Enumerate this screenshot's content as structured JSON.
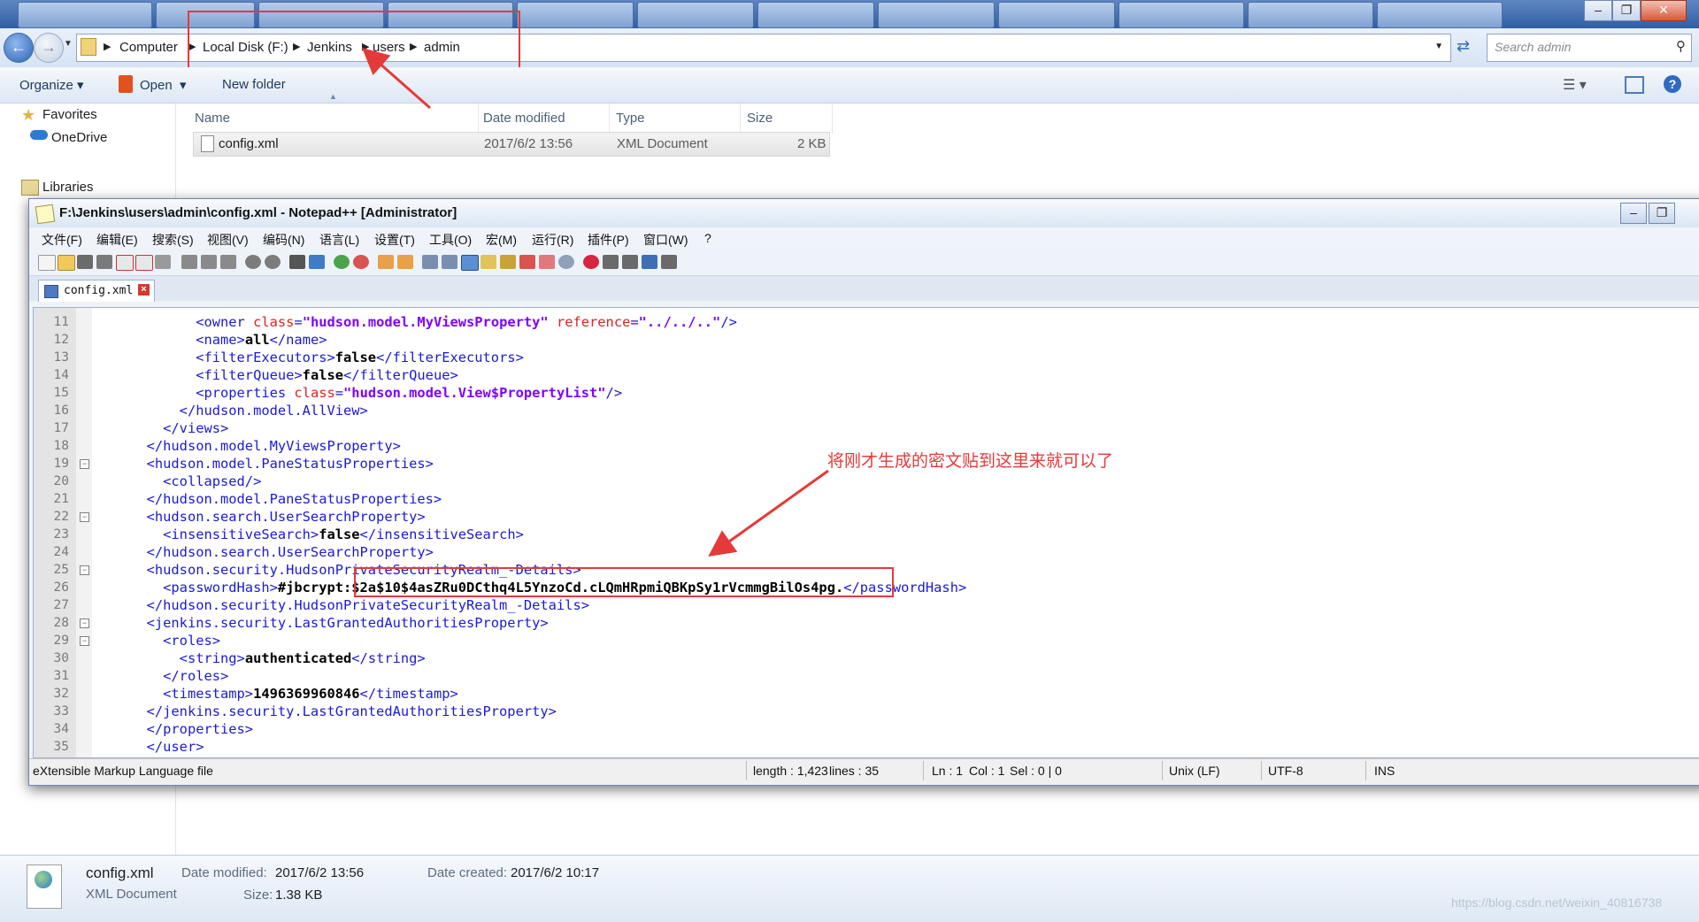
{
  "explorer": {
    "breadcrumbs": [
      "Computer",
      "Local Disk (F:)",
      "Jenkins",
      "users",
      "admin"
    ],
    "search_placeholder": "Search admin",
    "toolbar": {
      "organize": "Organize",
      "open": "Open",
      "new_folder": "New folder"
    },
    "nav": {
      "favorites": "Favorites",
      "onedrive": "OneDrive",
      "libraries": "Libraries"
    },
    "columns": {
      "name": "Name",
      "date_modified": "Date modified",
      "type": "Type",
      "size": "Size"
    },
    "file": {
      "name": "config.xml",
      "date": "2017/6/2 13:56",
      "type": "XML Document",
      "size": "2 KB"
    },
    "details": {
      "name": "config.xml",
      "kind": "XML Document",
      "date_modified_label": "Date modified:",
      "date_modified": "2017/6/2 13:56",
      "size_label": "Size:",
      "size": "1.38 KB",
      "date_created_label": "Date created:",
      "date_created": "2017/6/2 10:17"
    }
  },
  "notepad": {
    "title": "F:\\Jenkins\\users\\admin\\config.xml - Notepad++ [Administrator]",
    "menu": [
      "文件(F)",
      "编辑(E)",
      "搜索(S)",
      "视图(V)",
      "编码(N)",
      "语言(L)",
      "设置(T)",
      "工具(O)",
      "宏(M)",
      "运行(R)",
      "插件(P)",
      "窗口(W)",
      "?"
    ],
    "tab": "config.xml",
    "lines": [
      {
        "n": "11",
        "p": [
          [
            "      ",
            ""
          ],
          [
            "<owner ",
            "tag"
          ],
          [
            "class",
            "attr"
          ],
          [
            "=",
            "tag"
          ],
          [
            "\"hudson.model.MyViewsProperty\"",
            "val"
          ],
          [
            " reference",
            "attr"
          ],
          [
            "=",
            "tag"
          ],
          [
            "\"../../..\"",
            "val"
          ],
          [
            "/>",
            "tag"
          ]
        ]
      },
      {
        "n": "12",
        "p": [
          [
            "      ",
            ""
          ],
          [
            "<name>",
            "tag"
          ],
          [
            "all",
            "txt"
          ],
          [
            "</name>",
            "tag"
          ]
        ]
      },
      {
        "n": "13",
        "p": [
          [
            "      ",
            ""
          ],
          [
            "<filterExecutors>",
            "tag"
          ],
          [
            "false",
            "txt"
          ],
          [
            "</filterExecutors>",
            "tag"
          ]
        ]
      },
      {
        "n": "14",
        "p": [
          [
            "      ",
            ""
          ],
          [
            "<filterQueue>",
            "tag"
          ],
          [
            "false",
            "txt"
          ],
          [
            "</filterQueue>",
            "tag"
          ]
        ]
      },
      {
        "n": "15",
        "p": [
          [
            "      ",
            ""
          ],
          [
            "<properties ",
            "tag"
          ],
          [
            "class",
            "attr"
          ],
          [
            "=",
            "tag"
          ],
          [
            "\"hudson.model.View$PropertyList\"",
            "val"
          ],
          [
            "/>",
            "tag"
          ]
        ]
      },
      {
        "n": "16",
        "p": [
          [
            "    ",
            ""
          ],
          [
            "</hudson.model.AllView>",
            "tag"
          ]
        ]
      },
      {
        "n": "17",
        "p": [
          [
            "  ",
            ""
          ],
          [
            "</views>",
            "tag"
          ]
        ]
      },
      {
        "n": "18",
        "p": [
          [
            "",
            ""
          ],
          [
            "</hudson.model.MyViewsProperty>",
            "tag"
          ]
        ]
      },
      {
        "n": "19",
        "p": [
          [
            "",
            ""
          ],
          [
            "<hudson.model.PaneStatusProperties>",
            "tag"
          ]
        ]
      },
      {
        "n": "20",
        "p": [
          [
            "  ",
            ""
          ],
          [
            "<collapsed/>",
            "tag"
          ]
        ]
      },
      {
        "n": "21",
        "p": [
          [
            "",
            ""
          ],
          [
            "</hudson.model.PaneStatusProperties>",
            "tag"
          ]
        ]
      },
      {
        "n": "22",
        "p": [
          [
            "",
            ""
          ],
          [
            "<hudson.search.UserSearchProperty>",
            "tag"
          ]
        ]
      },
      {
        "n": "23",
        "p": [
          [
            "  ",
            ""
          ],
          [
            "<insensitiveSearch>",
            "tag"
          ],
          [
            "false",
            "txt"
          ],
          [
            "</insensitiveSearch>",
            "tag"
          ]
        ]
      },
      {
        "n": "24",
        "p": [
          [
            "",
            ""
          ],
          [
            "</hudson.search.UserSearchProperty>",
            "tag"
          ]
        ]
      },
      {
        "n": "25",
        "p": [
          [
            "",
            ""
          ],
          [
            "<hudson.security.HudsonPrivateSecurityRealm_-Details>",
            "tag"
          ]
        ]
      },
      {
        "n": "26",
        "p": [
          [
            "  ",
            ""
          ],
          [
            "<passwordHash>",
            "tag"
          ],
          [
            "#jbcrypt:$2a$10$4asZRu0DCthq4L5YnzoCd.cLQmHRpmiQBKpSy1rVcmmgBilOs4pg.",
            "txt"
          ],
          [
            "</passwordHash>",
            "tag"
          ]
        ]
      },
      {
        "n": "27",
        "p": [
          [
            "",
            ""
          ],
          [
            "</hudson.security.HudsonPrivateSecurityRealm_-Details>",
            "tag"
          ]
        ]
      },
      {
        "n": "28",
        "p": [
          [
            "",
            ""
          ],
          [
            "<jenkins.security.LastGrantedAuthoritiesProperty>",
            "tag"
          ]
        ]
      },
      {
        "n": "29",
        "p": [
          [
            "  ",
            ""
          ],
          [
            "<roles>",
            "tag"
          ]
        ]
      },
      {
        "n": "30",
        "p": [
          [
            "    ",
            ""
          ],
          [
            "<string>",
            "tag"
          ],
          [
            "authenticated",
            "txt"
          ],
          [
            "</string>",
            "tag"
          ]
        ]
      },
      {
        "n": "31",
        "p": [
          [
            "  ",
            ""
          ],
          [
            "</roles>",
            "tag"
          ]
        ]
      },
      {
        "n": "32",
        "p": [
          [
            "  ",
            ""
          ],
          [
            "<timestamp>",
            "tag"
          ],
          [
            "1496369960846",
            "txt"
          ],
          [
            "</timestamp>",
            "tag"
          ]
        ]
      },
      {
        "n": "33",
        "p": [
          [
            "",
            ""
          ],
          [
            "</jenkins.security.LastGrantedAuthoritiesProperty>",
            "tag"
          ]
        ]
      },
      {
        "n": "34",
        "p": [
          [
            "",
            ""
          ],
          [
            "</properties>",
            "tag"
          ]
        ]
      },
      {
        "n": "35",
        "p": [
          [
            "",
            ""
          ],
          [
            "</user>",
            "tag"
          ]
        ]
      }
    ],
    "status": {
      "filetype": "eXtensible Markup Language file",
      "length": "length : 1,423",
      "lines": "lines : 35",
      "ln": "Ln : 1",
      "col": "Col : 1",
      "sel": "Sel : 0 | 0",
      "eol": "Unix (LF)",
      "encoding": "UTF-8",
      "mode": "INS"
    }
  },
  "annotation": "将刚才生成的密文贴到这里来就可以了",
  "watermark": "https://blog.csdn.net/weixin_40816738",
  "colors": {
    "annotation": "#e53a3a",
    "xml_tag": "#1a1ad6",
    "xml_attr": "#e02020",
    "xml_value": "#8000ff"
  }
}
